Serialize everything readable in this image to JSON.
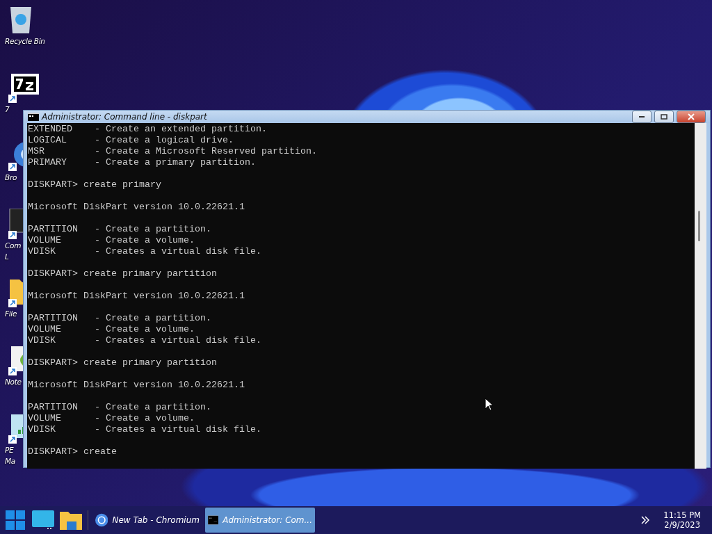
{
  "desktop_icons": [
    {
      "kind": "recycle",
      "label": "Recycle Bin"
    },
    {
      "kind": "sevenzip",
      "label": "7"
    },
    {
      "kind": "browser",
      "label": "Bro"
    },
    {
      "kind": "console",
      "label": "Com",
      "label_2": "L"
    },
    {
      "kind": "folder",
      "label": "File"
    },
    {
      "kind": "notepad",
      "label": "Note"
    },
    {
      "kind": "network",
      "label": "PE",
      "label_2": "Ma"
    }
  ],
  "window": {
    "title": "Administrator: Command line - diskpart",
    "console_blocks": [
      [
        "EXTENDED    - Create an extended partition.",
        "LOGICAL     - Create a logical drive.",
        "MSR         - Create a Microsoft Reserved partition.",
        "PRIMARY     - Create a primary partition."
      ],
      [
        "DISKPART> create primary"
      ],
      [
        "Microsoft DiskPart version 10.0.22621.1"
      ],
      [
        "PARTITION   - Create a partition.",
        "VOLUME      - Create a volume.",
        "VDISK       - Creates a virtual disk file."
      ],
      [
        "DISKPART> create primary partition"
      ],
      [
        "Microsoft DiskPart version 10.0.22621.1"
      ],
      [
        "PARTITION   - Create a partition.",
        "VOLUME      - Create a volume.",
        "VDISK       - Creates a virtual disk file."
      ],
      [
        "DISKPART> create primary partition"
      ],
      [
        "Microsoft DiskPart version 10.0.22621.1"
      ],
      [
        "PARTITION   - Create a partition.",
        "VOLUME      - Create a volume.",
        "VDISK       - Creates a virtual disk file."
      ],
      [
        "DISKPART> create"
      ]
    ]
  },
  "taskbar": {
    "pinned": [
      {
        "kind": "start"
      },
      {
        "kind": "monitor"
      },
      {
        "kind": "folder"
      }
    ],
    "tasks": [
      {
        "kind": "browser",
        "label": "New Tab - Chromium",
        "selected": false
      },
      {
        "kind": "console",
        "label": "Administrator: Com...",
        "selected": true
      }
    ],
    "clock": {
      "time": "11:15 PM",
      "date": "2/9/2023"
    }
  }
}
